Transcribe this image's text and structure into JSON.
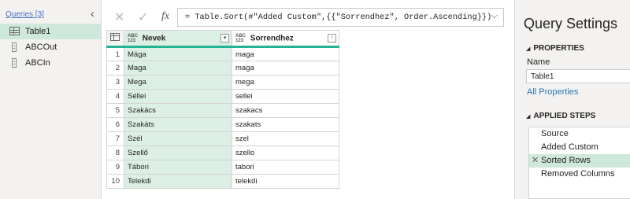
{
  "queries": {
    "title": "Queries [3]",
    "items": [
      {
        "label": "Table1",
        "icon": "table-icon",
        "selected": true
      },
      {
        "label": "ABCOut",
        "icon": "parameter-icon",
        "selected": false
      },
      {
        "label": "ABCIn",
        "icon": "parameter-icon",
        "selected": false
      }
    ]
  },
  "formula_bar": {
    "cancel_glyph": "✕",
    "commit_glyph": "✓",
    "fx_label": "fx",
    "formula": "= Table.Sort(#\"Added Custom\",{{\"Sorrendhez\", Order.Ascending}})"
  },
  "grid": {
    "type_tag": "ABC\n123",
    "columns": [
      {
        "label": "Nevek",
        "filter_glyph": "▾"
      },
      {
        "label": "Sorrendhez",
        "filter_glyph": "↑"
      }
    ],
    "rows": [
      {
        "num": "1",
        "nevek": "Mága",
        "sorrendhez": "maga"
      },
      {
        "num": "2",
        "nevek": "Maga",
        "sorrendhez": "maga"
      },
      {
        "num": "3",
        "nevek": "Mega",
        "sorrendhez": "mega"
      },
      {
        "num": "4",
        "nevek": "Séllei",
        "sorrendhez": "sellei"
      },
      {
        "num": "5",
        "nevek": "Szakács",
        "sorrendhez": "szakacs"
      },
      {
        "num": "6",
        "nevek": "Szakáts",
        "sorrendhez": "szakats"
      },
      {
        "num": "7",
        "nevek": "Szél",
        "sorrendhez": "szel"
      },
      {
        "num": "8",
        "nevek": "Szellő",
        "sorrendhez": "szello"
      },
      {
        "num": "9",
        "nevek": "Tábori",
        "sorrendhez": "tabori"
      },
      {
        "num": "10",
        "nevek": "Telekdi",
        "sorrendhez": "telekdi"
      }
    ]
  },
  "settings": {
    "title": "Query Settings",
    "properties_header": "PROPERTIES",
    "name_label": "Name",
    "name_value": "Table1",
    "all_properties": "All Properties",
    "applied_steps_header": "APPLIED STEPS",
    "steps": [
      {
        "label": "Source",
        "selected": false
      },
      {
        "label": "Added Custom",
        "selected": false
      },
      {
        "label": "Sorted Rows",
        "selected": true
      },
      {
        "label": "Removed Columns",
        "selected": false
      }
    ]
  },
  "colors": {
    "accent": "#23b393",
    "selected_bg": "#cfe8dc",
    "link": "#2e75b6"
  }
}
